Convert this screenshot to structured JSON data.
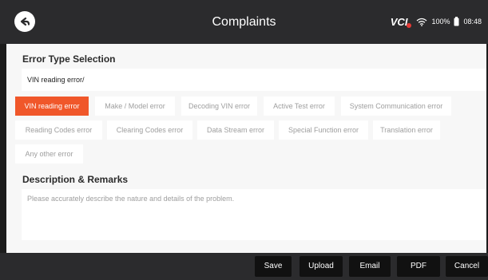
{
  "header": {
    "title": "Complaints",
    "vci_label": "VCI",
    "battery_text": "100%",
    "time": "08:48"
  },
  "error_type": {
    "heading": "Error Type Selection",
    "value": "VIN reading error/"
  },
  "chips": [
    "VIN reading error",
    "Make / Model error",
    "Decoding VIN error",
    "Active Test error",
    "System Communication error",
    "Reading Codes error",
    "Clearing Codes error",
    "Data Stream error",
    "Special Function error",
    "Translation error",
    "Any other error"
  ],
  "selected_chip": "VIN reading error",
  "description": {
    "heading": "Description & Remarks",
    "placeholder": "Please accurately describe the nature and details of the problem."
  },
  "footer": {
    "save": "Save",
    "upload": "Upload",
    "email": "Email",
    "pdf": "PDF",
    "cancel": "Cancel"
  },
  "colors": {
    "accent": "#f0572a",
    "topbar": "#2b2b2d",
    "panel": "#f7f7f7"
  },
  "icons": {
    "back": "back-arrow-icon",
    "wifi": "wifi-icon",
    "battery": "battery-icon"
  }
}
